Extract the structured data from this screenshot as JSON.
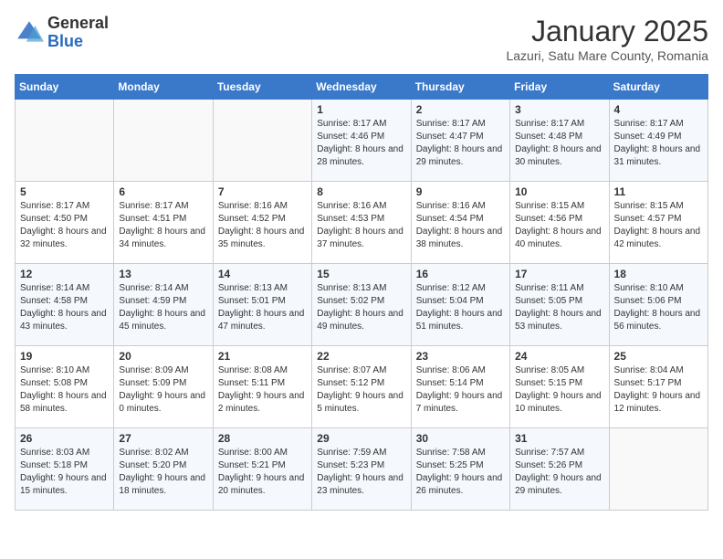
{
  "logo": {
    "general": "General",
    "blue": "Blue"
  },
  "title": "January 2025",
  "location": "Lazuri, Satu Mare County, Romania",
  "days_header": [
    "Sunday",
    "Monday",
    "Tuesday",
    "Wednesday",
    "Thursday",
    "Friday",
    "Saturday"
  ],
  "weeks": [
    [
      {
        "day": "",
        "info": ""
      },
      {
        "day": "",
        "info": ""
      },
      {
        "day": "",
        "info": ""
      },
      {
        "day": "1",
        "info": "Sunrise: 8:17 AM\nSunset: 4:46 PM\nDaylight: 8 hours and 28 minutes."
      },
      {
        "day": "2",
        "info": "Sunrise: 8:17 AM\nSunset: 4:47 PM\nDaylight: 8 hours and 29 minutes."
      },
      {
        "day": "3",
        "info": "Sunrise: 8:17 AM\nSunset: 4:48 PM\nDaylight: 8 hours and 30 minutes."
      },
      {
        "day": "4",
        "info": "Sunrise: 8:17 AM\nSunset: 4:49 PM\nDaylight: 8 hours and 31 minutes."
      }
    ],
    [
      {
        "day": "5",
        "info": "Sunrise: 8:17 AM\nSunset: 4:50 PM\nDaylight: 8 hours and 32 minutes."
      },
      {
        "day": "6",
        "info": "Sunrise: 8:17 AM\nSunset: 4:51 PM\nDaylight: 8 hours and 34 minutes."
      },
      {
        "day": "7",
        "info": "Sunrise: 8:16 AM\nSunset: 4:52 PM\nDaylight: 8 hours and 35 minutes."
      },
      {
        "day": "8",
        "info": "Sunrise: 8:16 AM\nSunset: 4:53 PM\nDaylight: 8 hours and 37 minutes."
      },
      {
        "day": "9",
        "info": "Sunrise: 8:16 AM\nSunset: 4:54 PM\nDaylight: 8 hours and 38 minutes."
      },
      {
        "day": "10",
        "info": "Sunrise: 8:15 AM\nSunset: 4:56 PM\nDaylight: 8 hours and 40 minutes."
      },
      {
        "day": "11",
        "info": "Sunrise: 8:15 AM\nSunset: 4:57 PM\nDaylight: 8 hours and 42 minutes."
      }
    ],
    [
      {
        "day": "12",
        "info": "Sunrise: 8:14 AM\nSunset: 4:58 PM\nDaylight: 8 hours and 43 minutes."
      },
      {
        "day": "13",
        "info": "Sunrise: 8:14 AM\nSunset: 4:59 PM\nDaylight: 8 hours and 45 minutes."
      },
      {
        "day": "14",
        "info": "Sunrise: 8:13 AM\nSunset: 5:01 PM\nDaylight: 8 hours and 47 minutes."
      },
      {
        "day": "15",
        "info": "Sunrise: 8:13 AM\nSunset: 5:02 PM\nDaylight: 8 hours and 49 minutes."
      },
      {
        "day": "16",
        "info": "Sunrise: 8:12 AM\nSunset: 5:04 PM\nDaylight: 8 hours and 51 minutes."
      },
      {
        "day": "17",
        "info": "Sunrise: 8:11 AM\nSunset: 5:05 PM\nDaylight: 8 hours and 53 minutes."
      },
      {
        "day": "18",
        "info": "Sunrise: 8:10 AM\nSunset: 5:06 PM\nDaylight: 8 hours and 56 minutes."
      }
    ],
    [
      {
        "day": "19",
        "info": "Sunrise: 8:10 AM\nSunset: 5:08 PM\nDaylight: 8 hours and 58 minutes."
      },
      {
        "day": "20",
        "info": "Sunrise: 8:09 AM\nSunset: 5:09 PM\nDaylight: 9 hours and 0 minutes."
      },
      {
        "day": "21",
        "info": "Sunrise: 8:08 AM\nSunset: 5:11 PM\nDaylight: 9 hours and 2 minutes."
      },
      {
        "day": "22",
        "info": "Sunrise: 8:07 AM\nSunset: 5:12 PM\nDaylight: 9 hours and 5 minutes."
      },
      {
        "day": "23",
        "info": "Sunrise: 8:06 AM\nSunset: 5:14 PM\nDaylight: 9 hours and 7 minutes."
      },
      {
        "day": "24",
        "info": "Sunrise: 8:05 AM\nSunset: 5:15 PM\nDaylight: 9 hours and 10 minutes."
      },
      {
        "day": "25",
        "info": "Sunrise: 8:04 AM\nSunset: 5:17 PM\nDaylight: 9 hours and 12 minutes."
      }
    ],
    [
      {
        "day": "26",
        "info": "Sunrise: 8:03 AM\nSunset: 5:18 PM\nDaylight: 9 hours and 15 minutes."
      },
      {
        "day": "27",
        "info": "Sunrise: 8:02 AM\nSunset: 5:20 PM\nDaylight: 9 hours and 18 minutes."
      },
      {
        "day": "28",
        "info": "Sunrise: 8:00 AM\nSunset: 5:21 PM\nDaylight: 9 hours and 20 minutes."
      },
      {
        "day": "29",
        "info": "Sunrise: 7:59 AM\nSunset: 5:23 PM\nDaylight: 9 hours and 23 minutes."
      },
      {
        "day": "30",
        "info": "Sunrise: 7:58 AM\nSunset: 5:25 PM\nDaylight: 9 hours and 26 minutes."
      },
      {
        "day": "31",
        "info": "Sunrise: 7:57 AM\nSunset: 5:26 PM\nDaylight: 9 hours and 29 minutes."
      },
      {
        "day": "",
        "info": ""
      }
    ]
  ]
}
